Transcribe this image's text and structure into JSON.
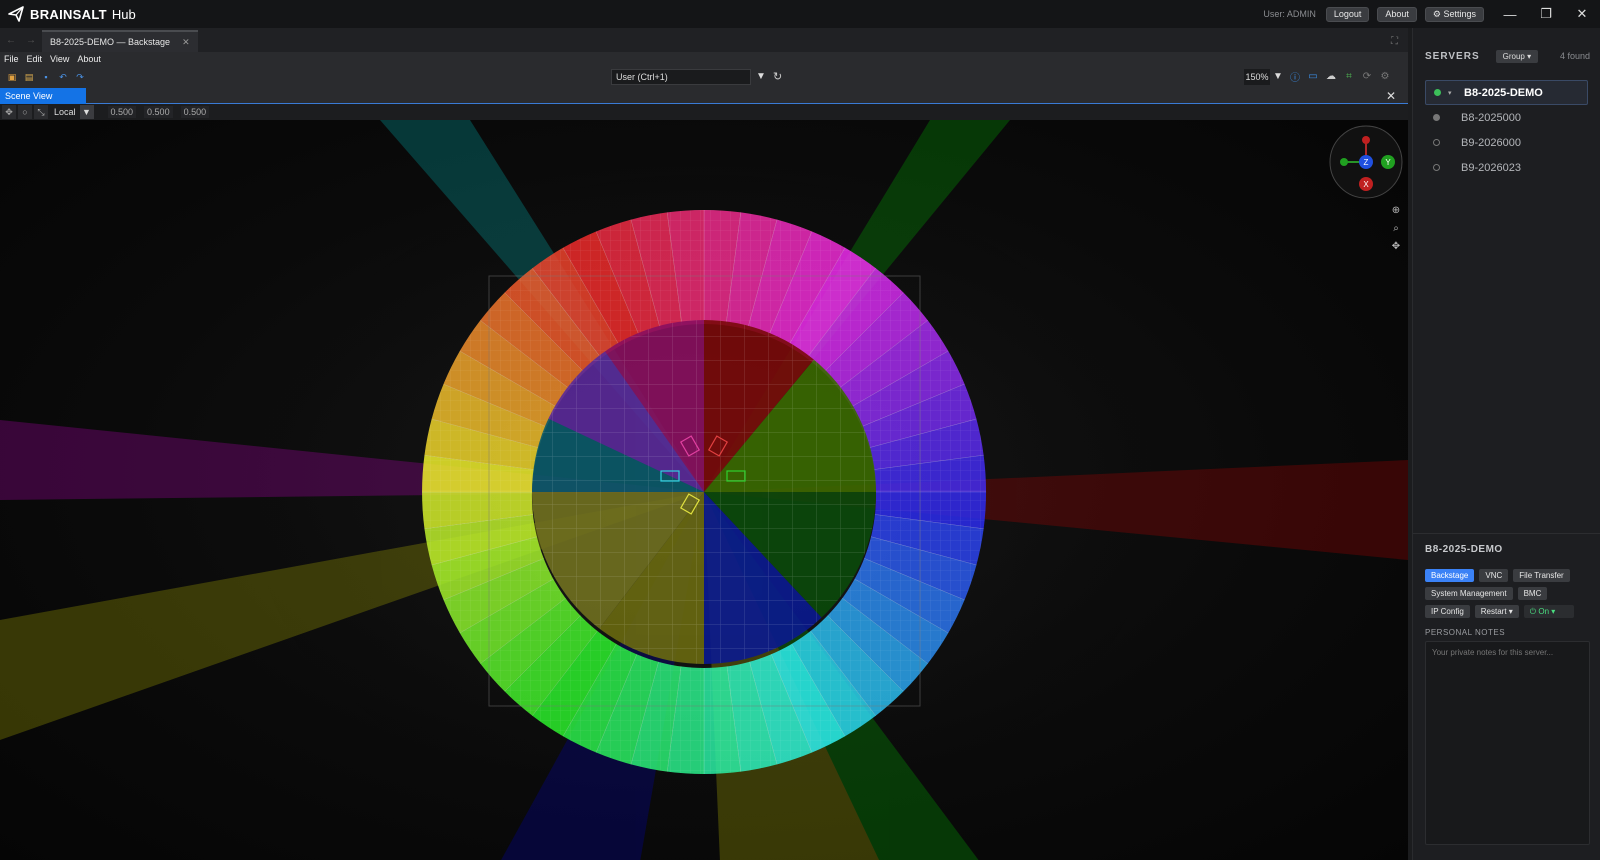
{
  "app": {
    "brand": "BRAINSALT",
    "product": "Hub",
    "user_label": "User: ADMIN",
    "logout": "Logout",
    "about": "About",
    "settings": "⚙ Settings"
  },
  "editor": {
    "tab_title": "B8-2025-DEMO — Backstage",
    "menu": [
      "File",
      "Edit",
      "View",
      "About"
    ],
    "user_select": "User  (Ctrl+1)",
    "zoom": "150%",
    "scene_tab": "Scene View",
    "space_label": "Local",
    "vector": [
      "0.500",
      "0.500",
      "0.500"
    ]
  },
  "gizmo": {
    "z": "Z",
    "y": "Y",
    "x": "X"
  },
  "servers": {
    "title": "SERVERS",
    "group_button": "Group ▾",
    "found": "4 found",
    "items": [
      {
        "name": "B8-2025-DEMO",
        "status": "online",
        "active": true
      },
      {
        "name": "B8-2025000",
        "status": "idle",
        "active": false
      },
      {
        "name": "B9-2026000",
        "status": "offline",
        "active": false
      },
      {
        "name": "B9-2026023",
        "status": "offline",
        "active": false
      }
    ]
  },
  "detail": {
    "title": "B8-2025-DEMO",
    "actions_row1": [
      "Backstage",
      "VNC",
      "File Transfer"
    ],
    "actions_row2": [
      "System Management",
      "BMC"
    ],
    "actions_row3": [
      "IP Config",
      "Restart ▾",
      "⏻ On ▾"
    ],
    "notes_label": "PERSONAL NOTES",
    "notes_placeholder": "Your private notes for this server..."
  }
}
